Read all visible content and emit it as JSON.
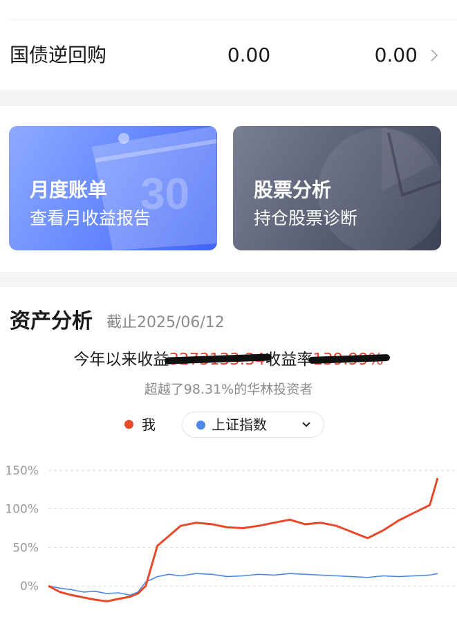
{
  "row": {
    "name": "国债逆回购",
    "value1": "0.00",
    "value2": "0.00"
  },
  "cards": [
    {
      "title": "月度账单",
      "subtitle": "查看月收益报告",
      "deco_text": "30"
    },
    {
      "title": "股票分析",
      "subtitle": "持仓股票诊断"
    }
  ],
  "analysis": {
    "title": "资产分析",
    "date": "截止2025/06/12",
    "ytd_label": "今年以来收益",
    "ytd_value": "3273133.34",
    "rate_label": "收益率",
    "rate_value": "139.99%",
    "beat_text": "超越了98.31%的华林投资者",
    "legend_me": "我",
    "index_select": "上证指数"
  },
  "colors": {
    "me": "#e8482a",
    "index": "#4a87e8",
    "card1": "#5b7dff",
    "card2": "#565b70"
  },
  "icons": {
    "row_arrow": "chevron-right-icon",
    "select_arrow": "chevron-down-icon"
  },
  "chart_data": {
    "type": "line",
    "yticks": [
      "150%",
      "100%",
      "50%",
      "0%"
    ],
    "ylim": [
      -20,
      150
    ],
    "x": [
      0,
      3,
      6,
      9,
      12,
      15,
      18,
      21,
      23,
      25,
      28,
      31,
      34,
      38,
      42,
      46,
      50,
      54,
      58,
      62,
      66,
      70,
      74,
      78,
      82,
      86,
      90,
      94,
      98,
      100
    ],
    "series": [
      {
        "name": "我",
        "values": [
          0,
          -8,
          -12,
          -15,
          -18,
          -20,
          -17,
          -14,
          -10,
          0,
          52,
          65,
          78,
          82,
          80,
          76,
          75,
          78,
          82,
          86,
          80,
          82,
          78,
          70,
          62,
          72,
          85,
          95,
          105,
          140
        ]
      },
      {
        "name": "上证指数",
        "values": [
          0,
          -3,
          -5,
          -8,
          -7,
          -10,
          -9,
          -12,
          -8,
          5,
          12,
          15,
          13,
          16,
          15,
          12,
          13,
          15,
          14,
          16,
          15,
          14,
          13,
          12,
          11,
          13,
          12,
          13,
          14,
          16
        ]
      }
    ],
    "grid": true,
    "legend_placement": "top-center"
  }
}
